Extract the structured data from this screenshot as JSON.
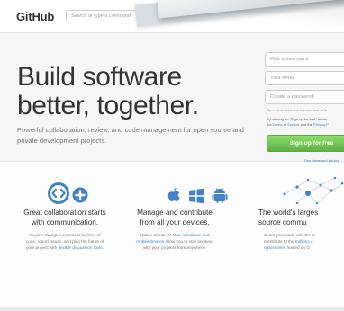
{
  "header": {
    "logo": "GitHub",
    "search_placeholder": "Search or type a command"
  },
  "hero": {
    "title": "Build software\nbetter, together.",
    "subtitle": "Powerful collaboration, review, and code management for open source and private development projects."
  },
  "signup_form": {
    "username_placeholder": "Pick a username",
    "email_placeholder": "Your email",
    "password_placeholder": "Create a password",
    "tip": "Tip: use at least one number and at le",
    "terms_prefix": "By clicking on \"Sign up for free\" below",
    "terms_middle": "the ",
    "terms_link": "Terms of Service",
    "terms_and": " and the ",
    "privacy_link": "Privacy P",
    "signup_button": "Sign up for free",
    "plans_link": "See plans and pricing"
  },
  "features": [
    {
      "title": "Great collaboration starts\nwith communication.",
      "desc_plain": "Review changes, comment on lines of\ncode, report issues, and plan the future of\nyour project with ",
      "desc_link": "flexible discussion tools",
      "desc_end": "."
    },
    {
      "title": "Manage and contribute\nfrom all your devices.",
      "desc_prefix": "Native clients for ",
      "desc_link1": "Mac",
      "desc_sep1": ", ",
      "desc_link2": "Windows",
      "desc_sep2": ", and",
      "desc_link3": "mobile devices",
      "desc_rest": " allow you to stay involved\nwith your projects from anywhere."
    },
    {
      "title": "The world's larges\nsource commu",
      "desc_plain": "Share your code with the w\ncontribute to the ",
      "desc_link": "millions o",
      "desc_link2": "repositories",
      "desc_end": " hosted on G"
    }
  ],
  "colors": {
    "accent_blue": "#4183c4",
    "signup_green": "#60b044",
    "icon_blue": "#4183c4"
  },
  "icons": [
    "comment-discussion-icon",
    "plus-circle-icon",
    "apple-icon",
    "windows-icon",
    "android-icon",
    "network-graph-icon"
  ]
}
